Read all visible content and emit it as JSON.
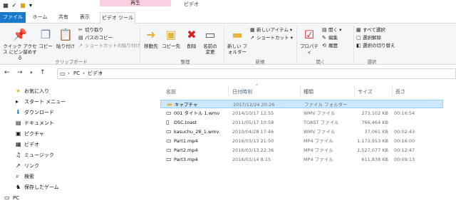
{
  "titlebar": {
    "context_tab": "再生",
    "window_title": "ビデオ"
  },
  "tabs": [
    "ファイル",
    "ホーム",
    "共有",
    "表示",
    "ビデオ ツール"
  ],
  "ribbon": {
    "clipboard": {
      "quick_access": "クイック アクセス にピン留めする",
      "copy": "コピー",
      "paste": "貼り付け",
      "cut": "切り取り",
      "copy_path": "パスのコピー",
      "paste_shortcut": "ショートカットの貼り付け",
      "group": "クリップボード"
    },
    "organize": {
      "move_to": "移動先",
      "copy_to": "コピー先",
      "delete": "削除",
      "rename": "名前の変更",
      "group": "整理"
    },
    "new": {
      "new_folder": "新しい フォルダー",
      "new_item": "新しいアイテム ▾",
      "shortcut": "ショートカット ▾",
      "group": "新規"
    },
    "open": {
      "properties": "プロパティ",
      "open": "開く ▾",
      "edit": "編集",
      "history": "履歴",
      "group": "開く"
    },
    "select": {
      "select_all": "すべて選択",
      "select_none": "選択解除",
      "invert": "選択の切り替え",
      "group": "選択"
    }
  },
  "address": {
    "path": [
      "PC",
      "ビデオ"
    ],
    "separator": "›"
  },
  "nav": [
    {
      "icon": "star-icon",
      "label": "お気に入り"
    },
    {
      "icon": "start-menu-icon",
      "label": "スタート メニュー"
    },
    {
      "icon": "download-icon",
      "label": "ダウンロード"
    },
    {
      "icon": "document-icon",
      "label": "ドキュメント"
    },
    {
      "icon": "picture-icon",
      "label": "ピクチャ"
    },
    {
      "icon": "video-icon",
      "label": "ビデオ"
    },
    {
      "icon": "music-icon",
      "label": "ミュージック"
    },
    {
      "icon": "link-icon",
      "label": "リンク"
    },
    {
      "icon": "search-icon",
      "label": "検索"
    },
    {
      "icon": "saved-games-icon",
      "label": "保存したゲーム"
    },
    {
      "icon": "pc-icon",
      "label": "PC"
    }
  ],
  "columns": {
    "name": "名前",
    "date": "日付時刻",
    "type": "種類",
    "size": "サイズ",
    "length": "長さ"
  },
  "files": [
    {
      "name": "キャプチャ",
      "date": "2017/12/24 20:26",
      "type": "ファイル フォルダー",
      "size": "",
      "length": "",
      "icon": "folder-icon"
    },
    {
      "name": "001 タイトル 1.wmv",
      "date": "2014/10/17 12:55",
      "type": "WMV ファイル",
      "size": "273,102 KB",
      "length": "00:16:54",
      "icon": "video-file-icon"
    },
    {
      "name": "DSC.toast",
      "date": "2011/05/17 10:58",
      "type": "TOAST ファイル",
      "size": "766,464 KB",
      "length": "",
      "icon": "file-icon"
    },
    {
      "name": "kasuchu_28_1.wmv",
      "date": "2010/04/28 17:46",
      "type": "WMV ファイル",
      "size": "37,061 KB",
      "length": "00:02:43",
      "icon": "video-file-icon"
    },
    {
      "name": "Part1.mp4",
      "date": "2016/03/13 21:50",
      "type": "MP4 ファイル",
      "size": "1,173,953 KB",
      "length": "00:16:00",
      "icon": "video-file-icon"
    },
    {
      "name": "Part2.mp4",
      "date": "2016/03/13 22:36",
      "type": "MP4 ファイル",
      "size": "1,527,077 KB",
      "length": "00:12:47",
      "icon": "video-file-icon"
    },
    {
      "name": "Part3.mp4",
      "date": "2016/03/14 8:15",
      "type": "MP4 ファイル",
      "size": "611,838 KB",
      "length": "00:09:13",
      "icon": "video-file-icon"
    }
  ],
  "colors": {
    "accent": "#1979ca",
    "selection": "#cce8ff",
    "context_tab": "#fbd0e2"
  }
}
